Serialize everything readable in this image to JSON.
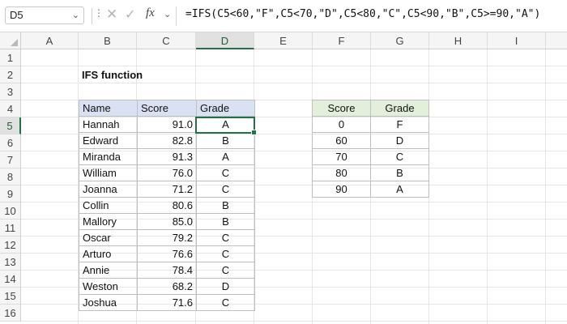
{
  "formula_bar": {
    "name_box": "D5",
    "formula": "=IFS(C5<60,\"F\",C5<70,\"D\",C5<80,\"C\",C5<90,\"B\",C5>=90,\"A\")",
    "fx_label": "fx"
  },
  "columns": [
    "A",
    "B",
    "C",
    "D",
    "E",
    "F",
    "G",
    "H",
    "I"
  ],
  "rows": [
    "1",
    "2",
    "3",
    "4",
    "5",
    "6",
    "7",
    "8",
    "9",
    "10",
    "11",
    "12",
    "13",
    "14",
    "15",
    "16"
  ],
  "selected_cell": {
    "column": "D",
    "row": "5"
  },
  "title": "IFS function",
  "main_table": {
    "headers": [
      "Name",
      "Score",
      "Grade"
    ],
    "rows": [
      [
        "Hannah",
        "91.0",
        "A"
      ],
      [
        "Edward",
        "82.8",
        "B"
      ],
      [
        "Miranda",
        "91.3",
        "A"
      ],
      [
        "William",
        "76.0",
        "C"
      ],
      [
        "Joanna",
        "71.2",
        "C"
      ],
      [
        "Collin",
        "80.6",
        "B"
      ],
      [
        "Mallory",
        "85.0",
        "B"
      ],
      [
        "Oscar",
        "79.2",
        "C"
      ],
      [
        "Arturo",
        "76.6",
        "C"
      ],
      [
        "Annie",
        "78.4",
        "C"
      ],
      [
        "Weston",
        "68.2",
        "D"
      ],
      [
        "Joshua",
        "71.6",
        "C"
      ]
    ]
  },
  "lookup_table": {
    "headers": [
      "Score",
      "Grade"
    ],
    "rows": [
      [
        "0",
        "F"
      ],
      [
        "60",
        "D"
      ],
      [
        "70",
        "C"
      ],
      [
        "80",
        "B"
      ],
      [
        "90",
        "A"
      ]
    ]
  },
  "colors": {
    "main_header_fill": "#d9e1f2",
    "lookup_header_fill": "#e2efda",
    "selection": "#217346"
  }
}
